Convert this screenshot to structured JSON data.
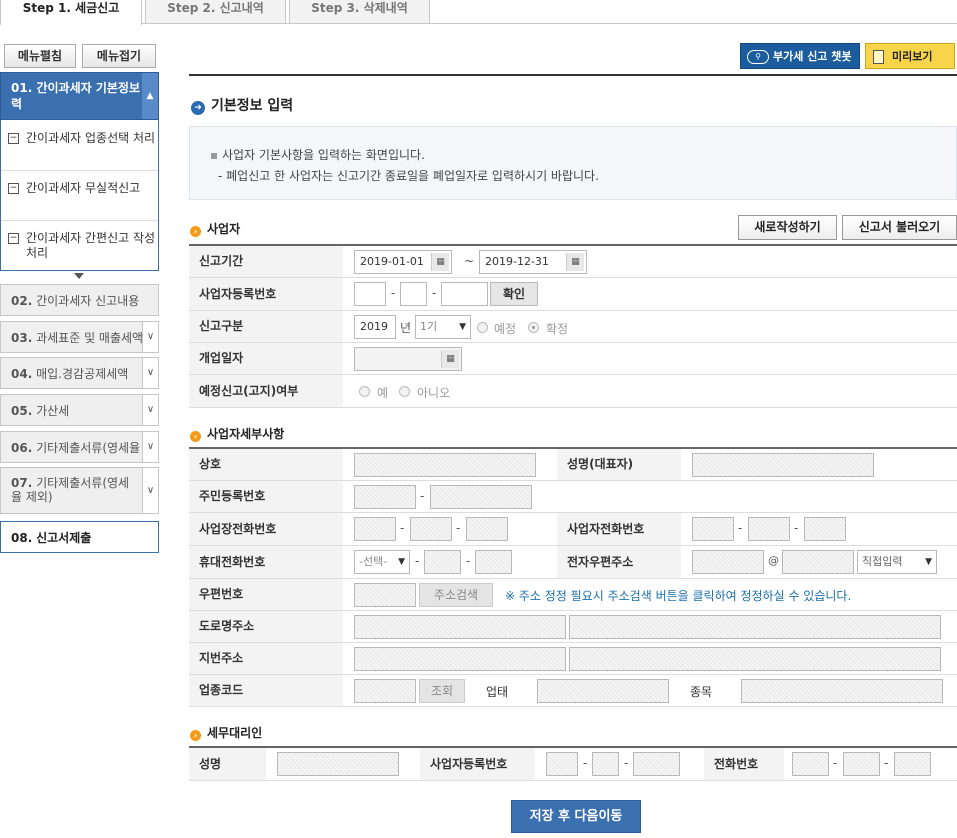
{
  "tabs": [
    {
      "label": "Step 1. 세금신고",
      "active": true
    },
    {
      "label": "Step 2. 신고내역",
      "active": false
    },
    {
      "label": "Step 3. 삭제내역",
      "active": false
    }
  ],
  "sidebar": {
    "expand_all": "메뉴펼침",
    "collapse_all": "메뉴접기",
    "active_item": {
      "num": "01.",
      "label": "간이과세자 기본정보 입력"
    },
    "sub_items": [
      "간이과세자 업종선택 처리",
      "간이과세자 무실적신고",
      "간이과세자 간편신고 작성 처리"
    ],
    "items": [
      {
        "num": "02.",
        "label": "간이과세자 신고내용"
      },
      {
        "num": "03.",
        "label": "과세표준 및 매출세액"
      },
      {
        "num": "04.",
        "label": "매입.경감공제세액"
      },
      {
        "num": "05.",
        "label": "가산세"
      },
      {
        "num": "06.",
        "label": "기타제출서류(영세율"
      },
      {
        "num": "07.",
        "label": "기타제출서류(영세율 제외)"
      },
      {
        "num": "08.",
        "label": "신고서제출"
      }
    ]
  },
  "header": {
    "chatbot_label": "부가세 신고 챗봇",
    "preview_label": "미리보기"
  },
  "page_title": "기본정보 입력",
  "info": {
    "line1": "사업자 기본사항을 입력하는 화면입니다.",
    "line2": "- 폐업신고 한 사업자는 신고기간 종료일을 폐업일자로 입력하시기 바랍니다."
  },
  "business": {
    "title": "사업자",
    "new_button": "새로작성하기",
    "load_button": "신고서 불러오기",
    "period_label": "신고기간",
    "period_start": "2019-01-01",
    "period_sep": "~",
    "period_end": "2019-12-31",
    "regno_label": "사업자등록번호",
    "confirm_button": "확인",
    "type_label": "신고구분",
    "year": "2019",
    "year_unit": "년",
    "term": "1기",
    "type_options": [
      "예정",
      "확정"
    ],
    "type_selected": "확정",
    "open_date_label": "개업일자",
    "notice_label": "예정신고(고지)여부",
    "notice_options": [
      "예",
      "아니오"
    ]
  },
  "details": {
    "title": "사업자세부사항",
    "company_label": "상호",
    "ceo_label": "성명(대표자)",
    "rrn_label": "주민등록번호",
    "office_phone_label": "사업장전화번호",
    "biz_phone_label": "사업자전화번호",
    "mobile_label": "휴대전화번호",
    "mobile_select": "-선택-",
    "email_label": "전자우편주소",
    "email_at": "@",
    "email_domain_select": "직접입력",
    "zip_label": "우편번호",
    "address_search_button": "주소검색",
    "address_note": "※ 주소 정정 필요시 주소검색 버튼을 클릭하여 정정하실 수 있습니다.",
    "road_addr_label": "도로명주소",
    "lot_addr_label": "지번주소",
    "industry_code_label": "업종코드",
    "lookup_button": "조회",
    "business_type_label": "업태",
    "business_item_label": "종목"
  },
  "agent": {
    "title": "세무대리인",
    "name_label": "성명",
    "regno_label": "사업자등록번호",
    "phone_label": "전화번호"
  },
  "dash": "-",
  "submit_label": "저장 후 다음이동"
}
